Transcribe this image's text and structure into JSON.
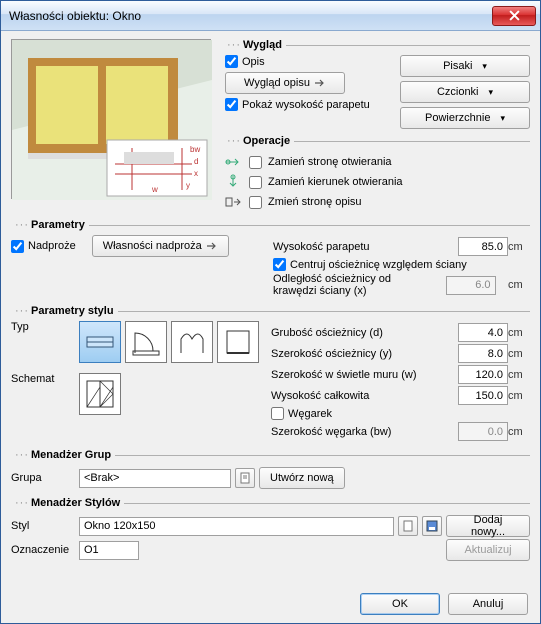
{
  "title": "Własności obiektu: Okno",
  "appearance": {
    "legend": "Wygląd",
    "opis_label": "Opis",
    "wyglad_opisu_btn": "Wygląd opisu",
    "pokaz_wysokosc_label": "Pokaż wysokość parapetu",
    "btn_pisaki": "Pisaki",
    "btn_czcionki": "Czcionki",
    "btn_powierzchnie": "Powierzchnie"
  },
  "operations": {
    "legend": "Operacje",
    "op1": "Zamień stronę otwierania",
    "op2": "Zamień kierunek otwierania",
    "op3": "Zmień stronę opisu"
  },
  "parametry": {
    "legend": "Parametry",
    "nadproze_label": "Nadproże",
    "wlas_nadproza_btn": "Własności nadproża",
    "wys_parapetu_label": "Wysokość parapetu",
    "wys_parapetu_val": "85.0",
    "centruj_label": "Centruj ościeżnicę względem ściany",
    "odleglosc_label": "Odległość ościeżnicy od krawędzi ściany (x)",
    "odleglosc_val": "6.0",
    "unit": "cm"
  },
  "styl": {
    "legend": "Parametry stylu",
    "typ_label": "Typ",
    "schemat_label": "Schemat",
    "p1_label": "Grubość ościeżnicy (d)",
    "p1_val": "4.0",
    "p2_label": "Szerokość ościeżnicy (y)",
    "p2_val": "8.0",
    "p3_label": "Szerokość w świetle muru (w)",
    "p3_val": "120.0",
    "p4_label": "Wysokość całkowita",
    "p4_val": "150.0",
    "wegarek_label": "Węgarek",
    "p5_label": "Szerokość węgarka (bw)",
    "p5_val": "0.0",
    "unit": "cm"
  },
  "grupy": {
    "legend": "Menadżer Grup",
    "grupa_label": "Grupa",
    "grupa_val": "<Brak>",
    "utworz_btn": "Utwórz nową"
  },
  "stylem": {
    "legend": "Menadżer Stylów",
    "styl_label": "Styl",
    "styl_val": "Okno 120x150",
    "dodaj_btn": "Dodaj nowy...",
    "ozn_label": "Oznaczenie",
    "ozn_val": "O1",
    "akt_btn": "Aktualizuj"
  },
  "footer": {
    "ok": "OK",
    "cancel": "Anuluj"
  }
}
